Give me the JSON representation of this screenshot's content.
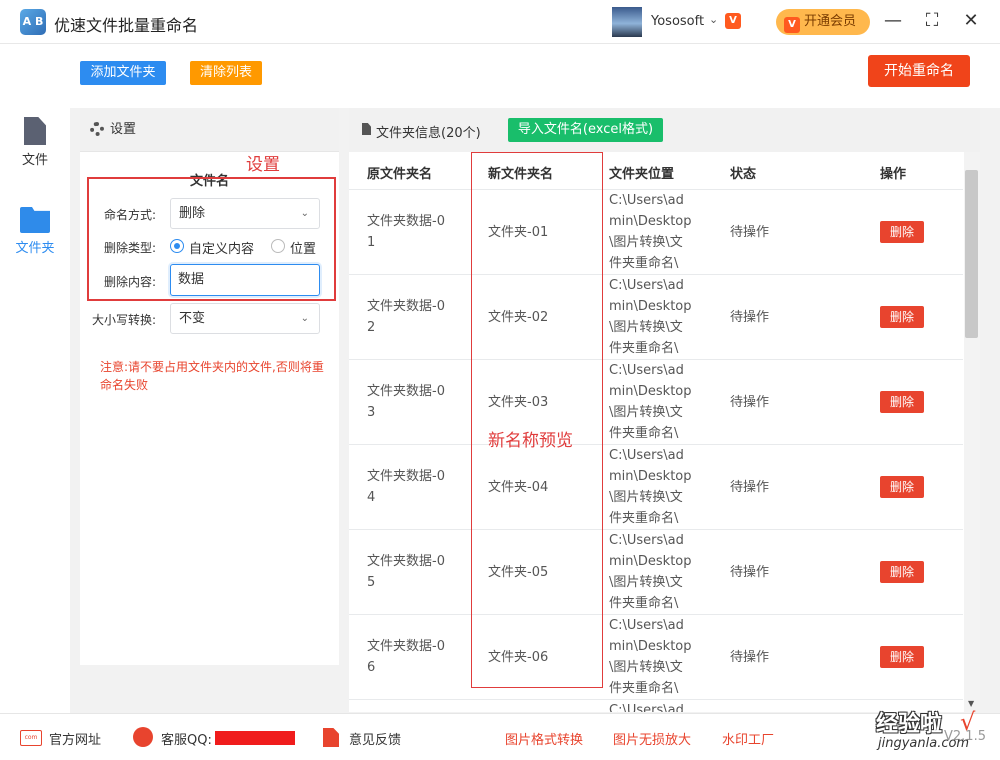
{
  "app": {
    "logo_text": "A B",
    "title": "优速文件批量重命名",
    "user_name": "Yososoft",
    "vip_button": "开通会员",
    "window_controls": {
      "minimize": "—",
      "maximize": "⛶",
      "close": "✕"
    }
  },
  "nav": {
    "items": [
      {
        "label": "文件",
        "icon": "file-icon",
        "active": false
      },
      {
        "label": "文件夹",
        "icon": "folder-icon",
        "active": true
      }
    ]
  },
  "toolbar": {
    "add_folder": "添加文件夹",
    "clear_list": "清除列表",
    "start_rename": "开始重命名"
  },
  "settings": {
    "header": "设置",
    "section_title": "文件名",
    "naming_mode_label": "命名方式:",
    "naming_mode_value": "删除",
    "delete_type_label": "删除类型:",
    "delete_type_options": [
      "自定义内容",
      "位置"
    ],
    "delete_type_selected": "自定义内容",
    "delete_content_label": "删除内容:",
    "delete_content_value": "数据",
    "case_label": "大小写转换:",
    "case_value": "不变",
    "notice": "注意:请不要占用文件夹内的文件,否则将重命名失败"
  },
  "annotations": {
    "settings_label": "设置",
    "preview_label": "新名称预览"
  },
  "table": {
    "title": "文件夹信息(20个)",
    "import_button": "导入文件名(excel格式)",
    "columns": [
      "原文件夹名",
      "新文件夹名",
      "文件夹位置",
      "状态",
      "操作"
    ],
    "rows": [
      {
        "orig_line1": "文件夹数据-0",
        "orig_line2": "1",
        "new": "文件夹-01",
        "path": [
          "C:\\Users\\ad",
          "min\\Desktop",
          "\\图片转换\\文",
          "件夹重命名\\"
        ],
        "status": "待操作",
        "action": "删除"
      },
      {
        "orig_line1": "文件夹数据-0",
        "orig_line2": "2",
        "new": "文件夹-02",
        "path": [
          "C:\\Users\\ad",
          "min\\Desktop",
          "\\图片转换\\文",
          "件夹重命名\\"
        ],
        "status": "待操作",
        "action": "删除"
      },
      {
        "orig_line1": "文件夹数据-0",
        "orig_line2": "3",
        "new": "文件夹-03",
        "path": [
          "C:\\Users\\ad",
          "min\\Desktop",
          "\\图片转换\\文",
          "件夹重命名\\"
        ],
        "status": "待操作",
        "action": "删除"
      },
      {
        "orig_line1": "文件夹数据-0",
        "orig_line2": "4",
        "new": "文件夹-04",
        "path": [
          "C:\\Users\\ad",
          "min\\Desktop",
          "\\图片转换\\文",
          "件夹重命名\\"
        ],
        "status": "待操作",
        "action": "删除"
      },
      {
        "orig_line1": "文件夹数据-0",
        "orig_line2": "5",
        "new": "文件夹-05",
        "path": [
          "C:\\Users\\ad",
          "min\\Desktop",
          "\\图片转换\\文",
          "件夹重命名\\"
        ],
        "status": "待操作",
        "action": "删除"
      },
      {
        "orig_line1": "文件夹数据-0",
        "orig_line2": "6",
        "new": "文件夹-06",
        "path": [
          "C:\\Users\\ad",
          "min\\Desktop",
          "\\图片转换\\文",
          "件夹重命名\\"
        ],
        "status": "待操作",
        "action": "删除"
      },
      {
        "orig_line1": "",
        "orig_line2": "",
        "new": "",
        "path": [
          "C:\\Users\\ad",
          "",
          "",
          ""
        ],
        "status": "",
        "action": ""
      }
    ]
  },
  "footer": {
    "official_site": "官方网址",
    "support_qq": "客服QQ:",
    "feedback": "意见反馈",
    "links": [
      "图片格式转换",
      "图片无损放大",
      "水印工厂"
    ],
    "version": "V2.1.5"
  },
  "watermark": {
    "title": "经验啦",
    "check": "√",
    "url": "jingyanla.com"
  },
  "colors": {
    "accent_blue": "#2d8cf0",
    "warn_orange": "#ff9900",
    "danger_red": "#e8442e",
    "success_green": "#19be6b",
    "vip_gold": "#ffb84d"
  }
}
